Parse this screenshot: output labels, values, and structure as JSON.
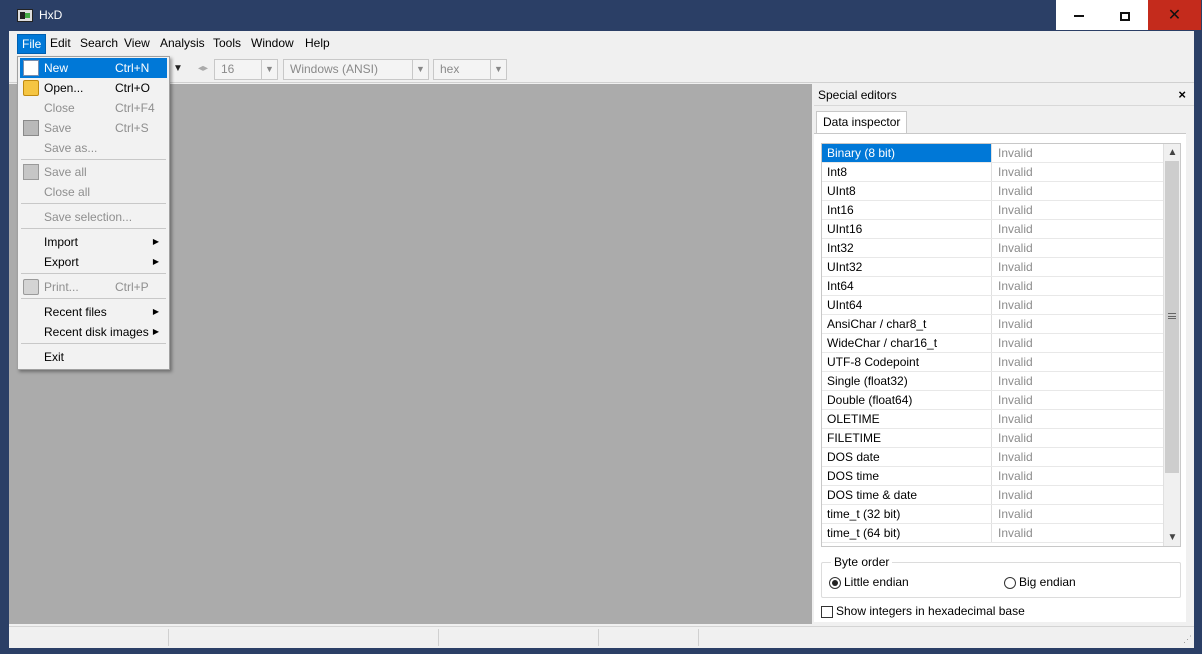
{
  "window": {
    "title": "HxD"
  },
  "menubar": {
    "items": [
      "File",
      "Edit",
      "Search",
      "View",
      "Analysis",
      "Tools",
      "Window",
      "Help"
    ]
  },
  "toolbar": {
    "bytes_per_row": "16",
    "charset": "Windows (ANSI)",
    "base": "hex"
  },
  "file_menu": {
    "new": {
      "label": "New",
      "shortcut": "Ctrl+N"
    },
    "open": {
      "label": "Open...",
      "shortcut": "Ctrl+O"
    },
    "close": {
      "label": "Close",
      "shortcut": "Ctrl+F4"
    },
    "save": {
      "label": "Save",
      "shortcut": "Ctrl+S"
    },
    "save_as": {
      "label": "Save as..."
    },
    "save_all": {
      "label": "Save all"
    },
    "close_all": {
      "label": "Close all"
    },
    "save_selection": {
      "label": "Save selection..."
    },
    "import": {
      "label": "Import"
    },
    "export": {
      "label": "Export"
    },
    "print": {
      "label": "Print...",
      "shortcut": "Ctrl+P"
    },
    "recent_files": {
      "label": "Recent files"
    },
    "recent_disk_images": {
      "label": "Recent disk images"
    },
    "exit": {
      "label": "Exit"
    }
  },
  "panel": {
    "title": "Special editors",
    "close": "×",
    "tab": "Data inspector",
    "rows": [
      {
        "name": "Binary (8 bit)",
        "value": "Invalid"
      },
      {
        "name": "Int8",
        "value": "Invalid"
      },
      {
        "name": "UInt8",
        "value": "Invalid"
      },
      {
        "name": "Int16",
        "value": "Invalid"
      },
      {
        "name": "UInt16",
        "value": "Invalid"
      },
      {
        "name": "Int32",
        "value": "Invalid"
      },
      {
        "name": "UInt32",
        "value": "Invalid"
      },
      {
        "name": "Int64",
        "value": "Invalid"
      },
      {
        "name": "UInt64",
        "value": "Invalid"
      },
      {
        "name": "AnsiChar / char8_t",
        "value": "Invalid"
      },
      {
        "name": "WideChar / char16_t",
        "value": "Invalid"
      },
      {
        "name": "UTF-8 Codepoint",
        "value": "Invalid"
      },
      {
        "name": "Single (float32)",
        "value": "Invalid"
      },
      {
        "name": "Double (float64)",
        "value": "Invalid"
      },
      {
        "name": "OLETIME",
        "value": "Invalid"
      },
      {
        "name": "FILETIME",
        "value": "Invalid"
      },
      {
        "name": "DOS date",
        "value": "Invalid"
      },
      {
        "name": "DOS time",
        "value": "Invalid"
      },
      {
        "name": "DOS time & date",
        "value": "Invalid"
      },
      {
        "name": "time_t (32 bit)",
        "value": "Invalid"
      },
      {
        "name": "time_t (64 bit)",
        "value": "Invalid"
      }
    ],
    "byte_order": {
      "label": "Byte order",
      "little": "Little endian",
      "big": "Big endian",
      "selected": "little"
    },
    "hex_integers": {
      "label": "Show integers in hexadecimal base",
      "checked": false
    }
  }
}
